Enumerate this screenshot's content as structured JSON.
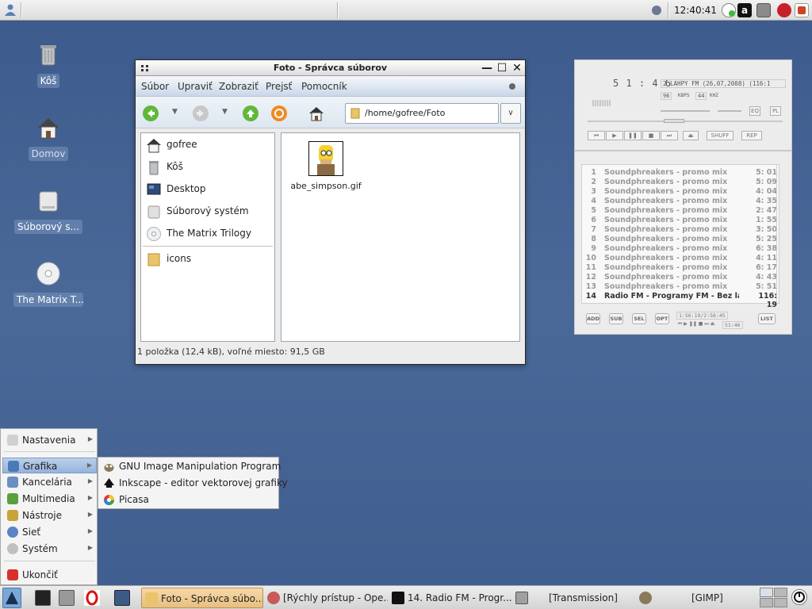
{
  "top_panel": {
    "clock": "12:40:41"
  },
  "desktop": {
    "icons": [
      {
        "label": "Kôš"
      },
      {
        "label": "Domov"
      },
      {
        "label": "Súborový s..."
      },
      {
        "label": "The Matrix T..."
      }
    ]
  },
  "file_manager": {
    "title": "Foto - Správca súborov",
    "menu": [
      "Súbor",
      "Upraviť",
      "Zobraziť",
      "Prejsť",
      "Pomocník"
    ],
    "location": "/home/gofree/Foto",
    "sidebar": [
      {
        "label": "gofree",
        "icon": "home-icon"
      },
      {
        "label": "Kôš",
        "icon": "trash-icon"
      },
      {
        "label": "Desktop",
        "icon": "desktop-icon"
      },
      {
        "label": "Súborový systém",
        "icon": "drive-icon"
      },
      {
        "label": "The Matrix Trilogy",
        "icon": "cd-icon"
      },
      {
        "label": "icons",
        "icon": "folder-icon"
      }
    ],
    "files": [
      {
        "name": "abe_simpson.gif"
      }
    ],
    "status": "1 položka (12,4 kB), voľné miesto: 91,5 GB"
  },
  "player": {
    "time": "5 1 : 4 6",
    "title_scroll": "2 LAHPY FM (26,07,2008) (116:1",
    "kbps": "96",
    "kbps_label": "KBPS",
    "khz": "44",
    "khz_label": "KHZ",
    "eq_label": "EQ",
    "pl_label": "PL",
    "shuffle_label": "SHUFF",
    "repeat_label": "REP"
  },
  "playlist": {
    "rows": [
      {
        "num": "1",
        "title": "Soundphreakers - promo mix",
        "dur": "5: 01"
      },
      {
        "num": "2",
        "title": "Soundphreakers - promo mix",
        "dur": "5: 09"
      },
      {
        "num": "3",
        "title": "Soundphreakers - promo mix",
        "dur": "4: 04"
      },
      {
        "num": "4",
        "title": "Soundphreakers - promo mix",
        "dur": "4: 35"
      },
      {
        "num": "5",
        "title": "Soundphreakers - promo mix",
        "dur": "2: 47"
      },
      {
        "num": "6",
        "title": "Soundphreakers - promo mix",
        "dur": "1: 55"
      },
      {
        "num": "7",
        "title": "Soundphreakers - promo mix",
        "dur": "3: 50"
      },
      {
        "num": "8",
        "title": "Soundphreakers - promo mix",
        "dur": "5: 25"
      },
      {
        "num": "9",
        "title": "Soundphreakers - promo mix",
        "dur": "6: 38"
      },
      {
        "num": "10",
        "title": "Soundphreakers - promo mix",
        "dur": "4: 11"
      },
      {
        "num": "11",
        "title": "Soundphreakers - promo mix",
        "dur": "6: 17"
      },
      {
        "num": "12",
        "title": "Soundphreakers - promo mix",
        "dur": "4: 43"
      },
      {
        "num": "13",
        "title": "Soundphreakers - promo mix",
        "dur": "5: 51"
      },
      {
        "num": "14",
        "title": "Radio FM - Programy FM - Bez la...",
        "dur": "116: 19"
      }
    ],
    "buttons": [
      "ADD",
      "SUB",
      "SEL",
      "OPT"
    ],
    "list_button": "LIST",
    "total_time": "1:56:19/2:56:45",
    "small_time": "51:46"
  },
  "start_menu": {
    "items": [
      {
        "label": "Nastavenia",
        "submenu": true
      },
      {
        "label": "Grafika",
        "submenu": true,
        "active": true
      },
      {
        "label": "Kancelária",
        "submenu": true
      },
      {
        "label": "Multimedia",
        "submenu": true
      },
      {
        "label": "Nástroje",
        "submenu": true
      },
      {
        "label": "Sieť",
        "submenu": true
      },
      {
        "label": "Systém",
        "submenu": true
      },
      {
        "label": "Ukončiť",
        "submenu": false
      }
    ],
    "submenu": [
      {
        "label": "GNU Image Manipulation Program",
        "icon": "gimp-icon"
      },
      {
        "label": "Inkscape - editor vektorovej grafiky",
        "icon": "inkscape-icon"
      },
      {
        "label": "Picasa",
        "icon": "picasa-icon"
      }
    ]
  },
  "taskbar": {
    "tasks": [
      {
        "label": "Foto - Správca súbo...",
        "active": true
      },
      {
        "label": "[Rýchly prístup - Ope..."
      },
      {
        "label": "14. Radio FM - Progr..."
      },
      {
        "label": "[Transmission]"
      },
      {
        "label": "[GIMP]"
      }
    ]
  },
  "colors": {
    "desktop": "#46628f",
    "menu_highlight": "#95b4dc",
    "active_task": "#e7bf80"
  }
}
